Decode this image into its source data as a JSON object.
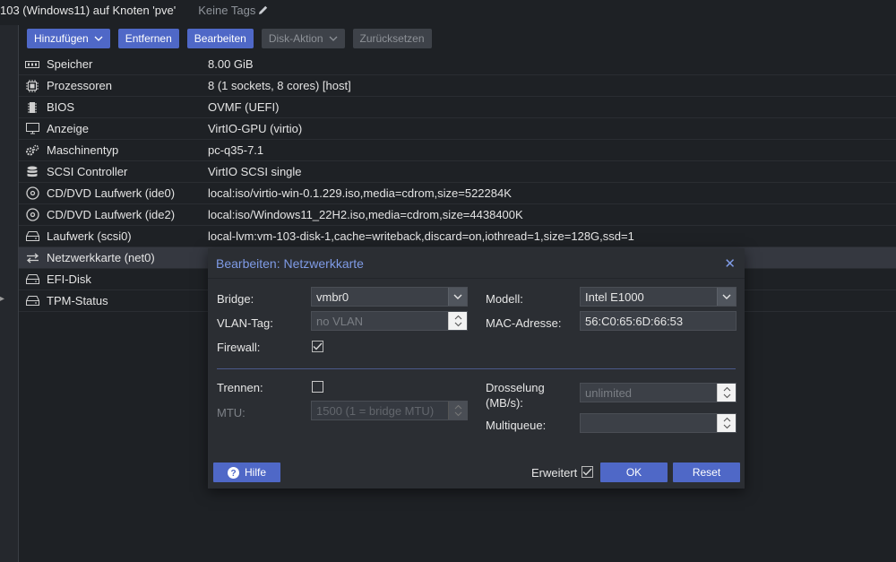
{
  "header": {
    "title": "103 (Windows11) auf Knoten 'pve'",
    "tags": "Keine Tags"
  },
  "toolbar": {
    "add": "Hinzufügen",
    "remove": "Entfernen",
    "edit": "Bearbeiten",
    "disk_action": "Disk-Aktion",
    "revert": "Zurücksetzen"
  },
  "hardware": [
    {
      "icon": "memory-icon",
      "name": "Speicher",
      "value": "8.00 GiB"
    },
    {
      "icon": "cpu-icon",
      "name": "Prozessoren",
      "value": "8 (1 sockets, 8 cores) [host]"
    },
    {
      "icon": "bios-icon",
      "name": "BIOS",
      "value": "OVMF (UEFI)"
    },
    {
      "icon": "monitor-icon",
      "name": "Anzeige",
      "value": "VirtIO-GPU (virtio)"
    },
    {
      "icon": "gears-icon",
      "name": "Maschinentyp",
      "value": "pc-q35-7.1"
    },
    {
      "icon": "database-icon",
      "name": "SCSI Controller",
      "value": "VirtIO SCSI single"
    },
    {
      "icon": "cdrom-icon",
      "name": "CD/DVD Laufwerk (ide0)",
      "value": "local:iso/virtio-win-0.1.229.iso,media=cdrom,size=522284K"
    },
    {
      "icon": "cdrom-icon",
      "name": "CD/DVD Laufwerk (ide2)",
      "value": "local:iso/Windows11_22H2.iso,media=cdrom,size=4438400K"
    },
    {
      "icon": "harddisk-icon",
      "name": "Laufwerk (scsi0)",
      "value": "local-lvm:vm-103-disk-1,cache=writeback,discard=on,iothread=1,size=128G,ssd=1"
    },
    {
      "icon": "network-icon",
      "name": "Netzwerkkarte (net0)",
      "value": ""
    },
    {
      "icon": "harddisk-icon",
      "name": "EFI-Disk",
      "value": ""
    },
    {
      "icon": "harddisk-icon",
      "name": "TPM-Status",
      "value": ""
    }
  ],
  "dialog": {
    "title": "Bearbeiten: Netzwerkkarte",
    "bridge_label": "Bridge:",
    "bridge_value": "vmbr0",
    "vlan_label": "VLAN-Tag:",
    "vlan_placeholder": "no VLAN",
    "firewall_label": "Firewall:",
    "firewall_checked": true,
    "model_label": "Modell:",
    "model_value": "Intel E1000",
    "mac_label": "MAC-Adresse:",
    "mac_value": "56:C0:65:6D:66:53",
    "disconnect_label": "Trennen:",
    "disconnect_checked": false,
    "mtu_label": "MTU:",
    "mtu_placeholder": "1500 (1 = bridge MTU)",
    "rate_label_1": "Drosselung",
    "rate_label_2": "(MB/s):",
    "rate_placeholder": "unlimited",
    "multiqueue_label": "Multiqueue:",
    "multiqueue_value": "",
    "help": "Hilfe",
    "advanced_label": "Erweitert",
    "advanced_checked": true,
    "ok": "OK",
    "reset": "Reset"
  },
  "colors": {
    "accent": "#4f68c7",
    "title_blue": "#7f9be6",
    "background": "#1e2125",
    "dialog_bg": "#2b2e33"
  }
}
